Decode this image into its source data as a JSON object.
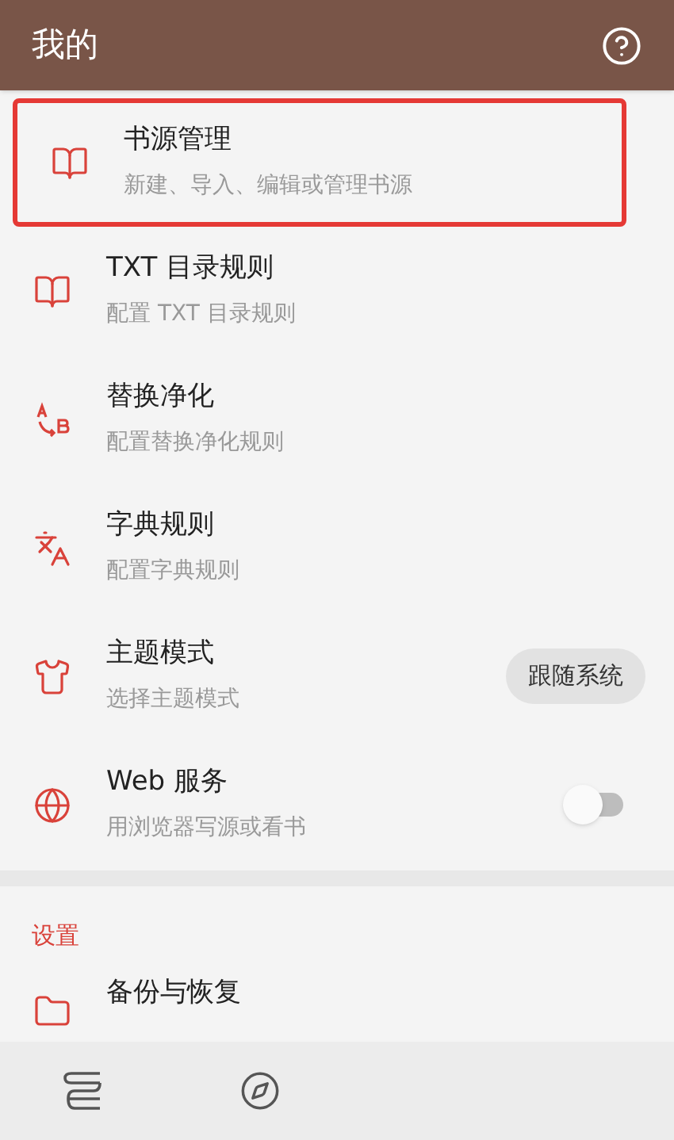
{
  "header": {
    "title": "我的"
  },
  "items": [
    {
      "kind": "plain",
      "title": "书源管理",
      "subtitle": "新建、导入、编辑或管理书源",
      "highlighted": true
    },
    {
      "kind": "plain",
      "title": "TXT 目录规则",
      "subtitle": "配置 TXT 目录规则",
      "highlighted": false
    },
    {
      "kind": "plain",
      "title": "替换净化",
      "subtitle": "配置替换净化规则",
      "highlighted": false
    },
    {
      "kind": "plain",
      "title": "字典规则",
      "subtitle": "配置字典规则",
      "highlighted": false
    },
    {
      "kind": "chip",
      "title": "主题模式",
      "subtitle": "选择主题模式",
      "value": "跟随系统",
      "highlighted": false
    },
    {
      "kind": "switch",
      "title": "Web 服务",
      "subtitle": "用浏览器写源或看书",
      "on": false,
      "highlighted": false
    }
  ],
  "settings": {
    "heading": "设置",
    "items": [
      {
        "title": "备份与恢复"
      }
    ]
  },
  "bottom_nav": [
    {
      "selected": false
    },
    {
      "selected": false
    }
  ]
}
